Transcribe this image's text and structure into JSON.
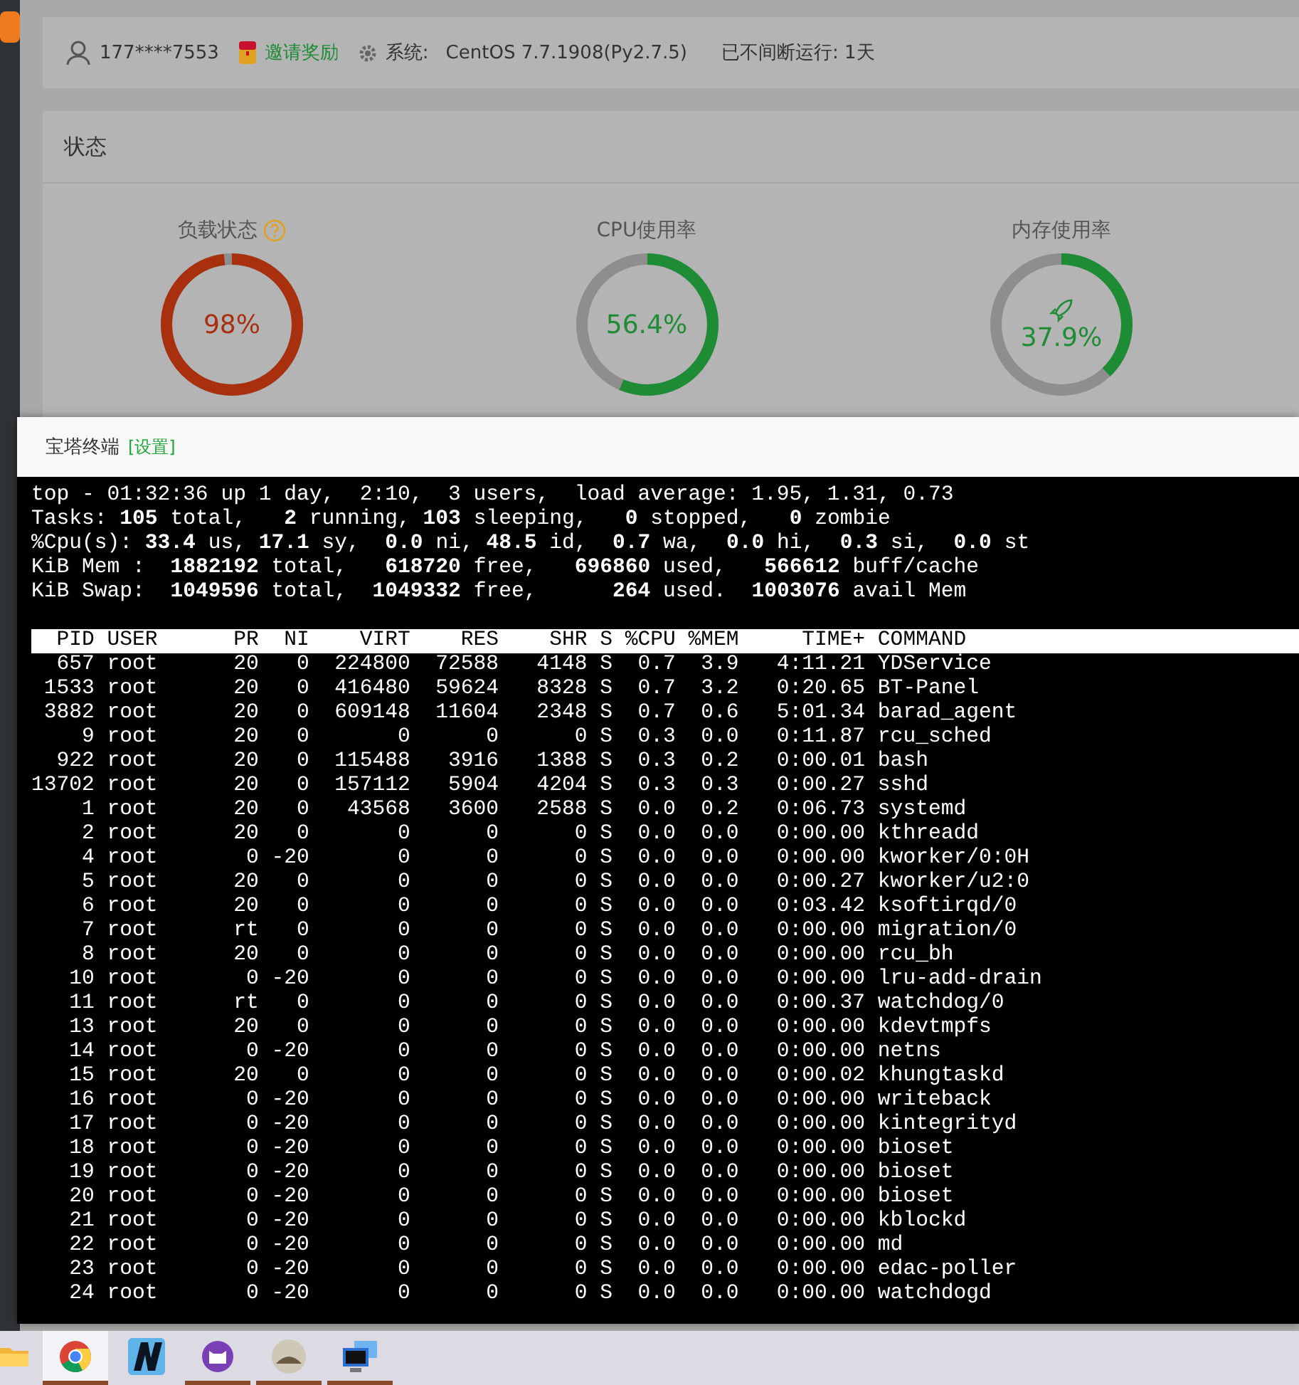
{
  "header": {
    "user": "177****7553",
    "invite": "邀请奖励",
    "system_label": "系统:",
    "system_value": "CentOS 7.7.1908(Py2.7.5)",
    "uptime": "已不间断运行: 1天"
  },
  "status": {
    "title": "状态",
    "gauges": [
      {
        "kind": "load",
        "title": "负载状态",
        "value": "98%",
        "level": 0.98,
        "color": "#a8300f"
      },
      {
        "kind": "cpu",
        "title": "CPU使用率",
        "value": "56.4%",
        "level": 0.564,
        "color": "#1e8c35"
      },
      {
        "kind": "memory",
        "title": "内存使用率",
        "value": "37.9%",
        "level": 0.379,
        "color": "#1e8c35"
      }
    ]
  },
  "terminal": {
    "title": "宝塔终端",
    "settings_link": "[设置]",
    "summary": [
      "top - 01:32:36 up 1 day,  2:10,  3 users,  load average: 1.95, 1.31, 0.73",
      "Tasks: **105** total,   **2** running, **103** sleeping,   **0** stopped,   **0** zombie",
      "%Cpu(s): **33.4** us, **17.1** sy,  **0.0** ni, **48.5** id,  **0.7** wa,  **0.0** hi,  **0.3** si,  **0.0** st",
      "KiB Mem :  **1882192** total,   **618720** free,   **696860** used,   **566612** buff/cache",
      "KiB Swap:  **1049596** total,  **1049332** free,      **264** used.  **1003076** avail Mem"
    ],
    "columns_line": "  PID USER      PR  NI    VIRT    RES    SHR S %CPU %MEM     TIME+ COMMAND",
    "rows": [
      "  657 root      20   0  224800  72588   4148 S  0.7  3.9   4:11.21 YDService",
      " 1533 root      20   0  416480  59624   8328 S  0.7  3.2   0:20.65 BT-Panel",
      " 3882 root      20   0  609148  11604   2348 S  0.7  0.6   5:01.34 barad_agent",
      "    9 root      20   0       0      0      0 S  0.3  0.0   0:11.87 rcu_sched",
      "  922 root      20   0  115488   3916   1388 S  0.3  0.2   0:00.01 bash",
      "13702 root      20   0  157112   5904   4204 S  0.3  0.3   0:00.27 sshd",
      "    1 root      20   0   43568   3600   2588 S  0.0  0.2   0:06.73 systemd",
      "    2 root      20   0       0      0      0 S  0.0  0.0   0:00.00 kthreadd",
      "    4 root       0 -20       0      0      0 S  0.0  0.0   0:00.00 kworker/0:0H",
      "    5 root      20   0       0      0      0 S  0.0  0.0   0:00.27 kworker/u2:0",
      "    6 root      20   0       0      0      0 S  0.0  0.0   0:03.42 ksoftirqd/0",
      "    7 root      rt   0       0      0      0 S  0.0  0.0   0:00.00 migration/0",
      "    8 root      20   0       0      0      0 S  0.0  0.0   0:00.00 rcu_bh",
      "   10 root       0 -20       0      0      0 S  0.0  0.0   0:00.00 lru-add-drain",
      "   11 root      rt   0       0      0      0 S  0.0  0.0   0:00.37 watchdog/0",
      "   13 root      20   0       0      0      0 S  0.0  0.0   0:00.00 kdevtmpfs",
      "   14 root       0 -20       0      0      0 S  0.0  0.0   0:00.00 netns",
      "   15 root      20   0       0      0      0 S  0.0  0.0   0:00.02 khungtaskd",
      "   16 root       0 -20       0      0      0 S  0.0  0.0   0:00.00 writeback",
      "   17 root       0 -20       0      0      0 S  0.0  0.0   0:00.00 kintegrityd",
      "   18 root       0 -20       0      0      0 S  0.0  0.0   0:00.00 bioset",
      "   19 root       0 -20       0      0      0 S  0.0  0.0   0:00.00 bioset",
      "   20 root       0 -20       0      0      0 S  0.0  0.0   0:00.00 bioset",
      "   21 root       0 -20       0      0      0 S  0.0  0.0   0:00.00 kblockd",
      "   22 root       0 -20       0      0      0 S  0.0  0.0   0:00.00 md",
      "   23 root       0 -20       0      0      0 S  0.0  0.0   0:00.00 edac-poller",
      "   24 root       0 -20       0      0      0 S  0.0  0.0   0:00.00 watchdogd"
    ]
  },
  "taskbar": {
    "items": [
      {
        "kind": "folder",
        "selected": false,
        "open": false
      },
      {
        "kind": "browser",
        "selected": true,
        "open": true
      },
      {
        "kind": "letter-app",
        "selected": false,
        "open": false
      },
      {
        "kind": "cat-app",
        "selected": false,
        "open": true
      },
      {
        "kind": "photo-app",
        "selected": false,
        "open": true
      },
      {
        "kind": "remote-desktop",
        "selected": false,
        "open": true
      }
    ]
  }
}
